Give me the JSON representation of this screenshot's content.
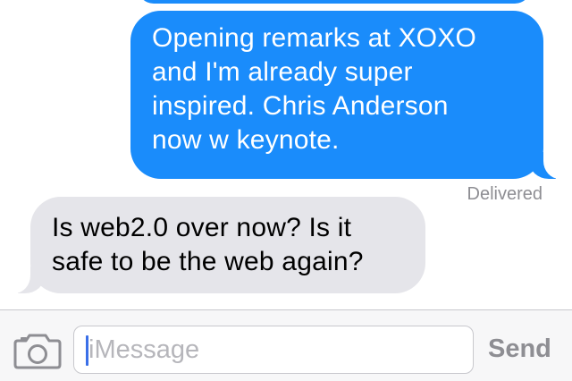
{
  "conversation": {
    "messages": [
      {
        "direction": "outgoing",
        "lines": [
          "Opening remarks at XOXO",
          "and I'm already super",
          "inspired. Chris Anderson",
          "now w keynote."
        ],
        "status": "Delivered"
      },
      {
        "direction": "incoming",
        "lines": [
          "Is web2.0 over now? Is it",
          "safe to be the web again?"
        ]
      }
    ]
  },
  "composer": {
    "camera_icon": "camera-icon",
    "placeholder": "iMessage",
    "value": "",
    "send_label": "Send"
  },
  "colors": {
    "outgoing_bubble": "#1a8cfb",
    "incoming_bubble": "#e5e5ea",
    "status_text": "#8e8e93",
    "send_disabled": "#8e8e93"
  }
}
